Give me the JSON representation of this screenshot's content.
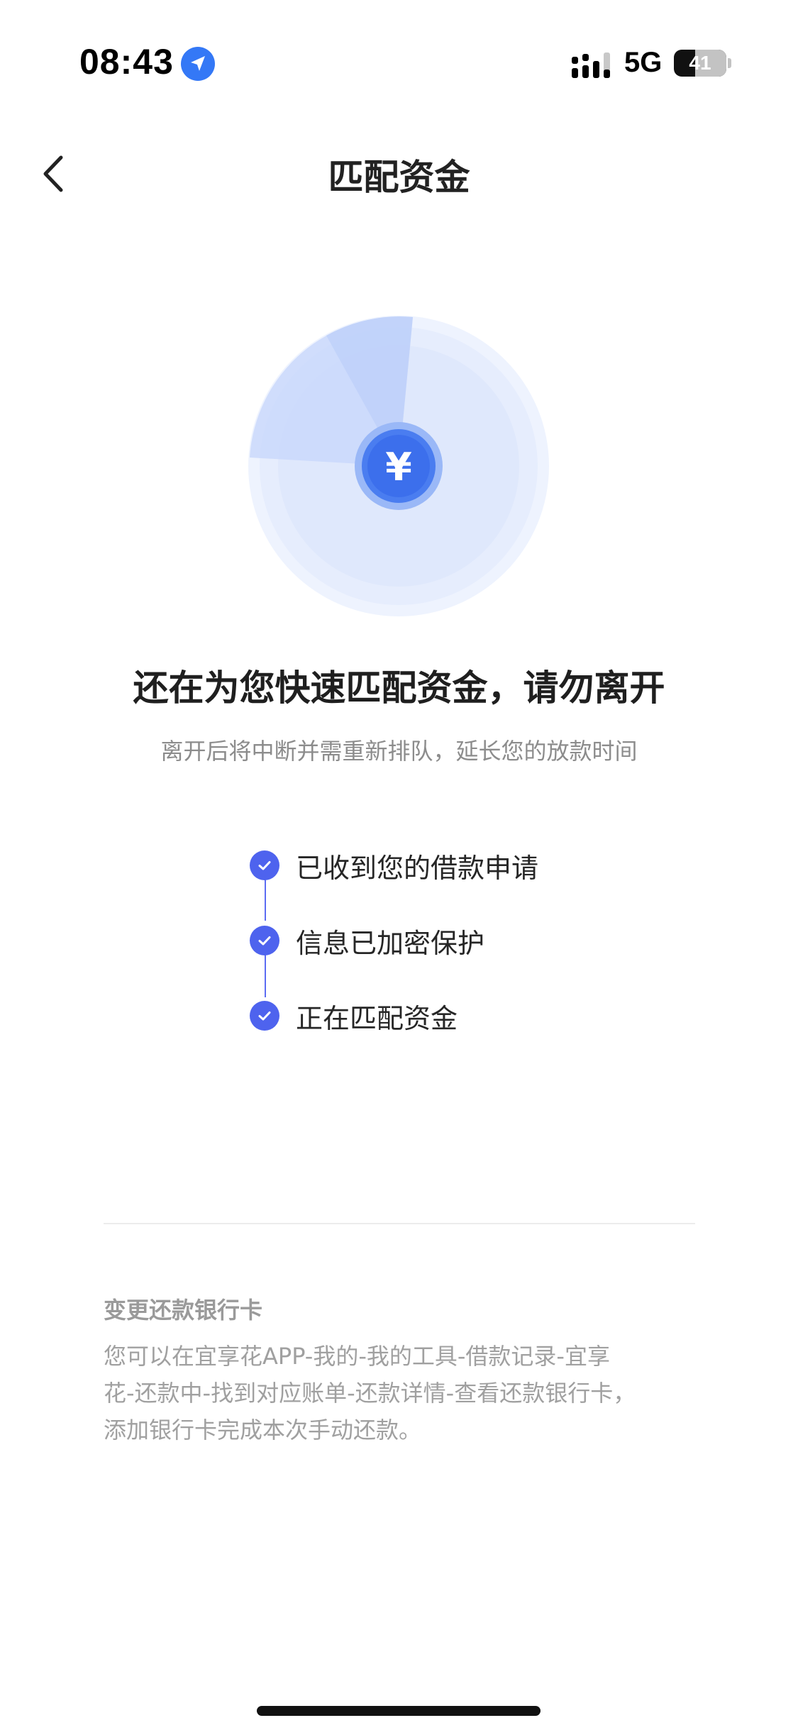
{
  "status_bar": {
    "time": "08:43",
    "network": "5G",
    "battery_level": "41",
    "icons": [
      "location-arrow-icon",
      "signal-icon",
      "battery-icon"
    ]
  },
  "nav": {
    "title": "匹配资金",
    "back_icon": "chevron-left-icon"
  },
  "radar": {
    "currency_symbol": "¥",
    "colors": {
      "outer": "#e9effd",
      "inner": "#dfe8fc",
      "sweep": "#c4d4fa",
      "coin": "#4a7df0",
      "coin_ring": "#7ea3f5"
    }
  },
  "main": {
    "headline": "还在为您快速匹配资金，请勿离开",
    "subline": "离开后将中断并需重新排队，延长您的放款时间"
  },
  "steps": [
    {
      "label": "已收到您的借款申请",
      "icon": "check-circle-icon"
    },
    {
      "label": "信息已加密保护",
      "icon": "check-circle-icon"
    },
    {
      "label": "正在匹配资金",
      "icon": "check-circle-icon"
    }
  ],
  "notice": {
    "title": "变更还款银行卡",
    "lines": [
      "您可以在宜享花APP-我的-我的工具-借款记录-宜享",
      "花-还款中-找到对应账单-还款详情-查看还款银行卡，",
      "添加银行卡完成本次手动还款。"
    ]
  },
  "theme": {
    "accent": "#4e63ee",
    "text_primary": "#1f1f1f",
    "text_secondary": "#8c8c8c"
  }
}
